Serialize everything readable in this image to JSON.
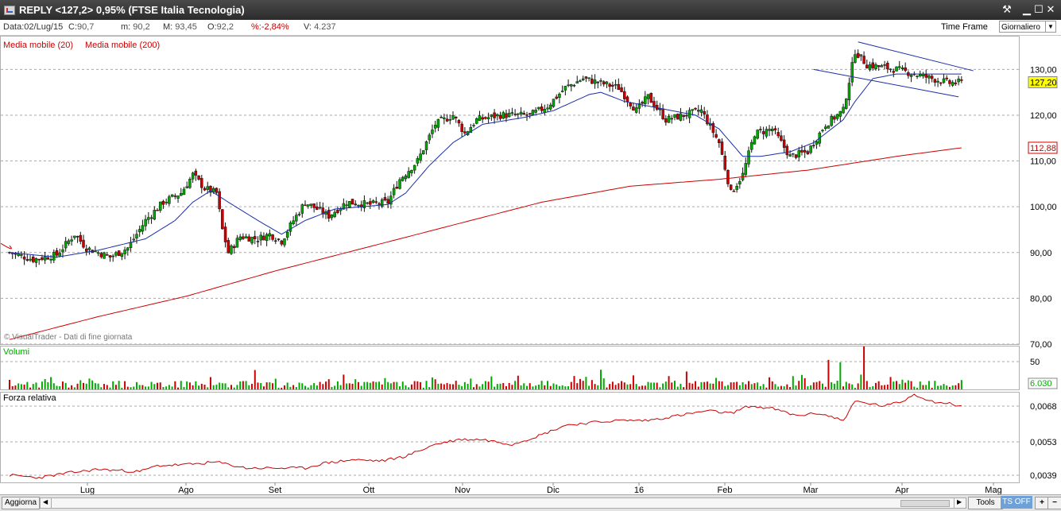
{
  "window": {
    "title": "REPLY <127,2> 0,95%  (FTSE Italia Tecnologia)",
    "controls": [
      "⚒",
      "▁",
      "☐",
      "✕"
    ]
  },
  "info": {
    "date": "Data:02/Lug/15",
    "close_label": "C:",
    "close": "90,7",
    "min_label": "m:",
    "min": "90,2",
    "max_label": "M:",
    "max": "93,45",
    "open_label": "O:",
    "open": "92,2",
    "pct_label": "%:",
    "pct": "-2,84%",
    "vol_label": "V:",
    "vol": "4.237",
    "timeframe_label": "Time Frame",
    "timeframe_value": "Giornaliero"
  },
  "bottom": {
    "update_label": "Aggiorna",
    "tools_label": "Tools",
    "ts_label": "TS OFF",
    "add": "+",
    "remove": "−"
  },
  "chart_data": [
    {
      "type": "candlestick",
      "legend": [
        "Media mobile (20)",
        "Media mobile (200)"
      ],
      "watermark": "© VisualTrader - Dati di fine giornata",
      "ylim": [
        70,
        137
      ],
      "y_ticks": [
        "70,00",
        "80,00",
        "90,00",
        "100,00",
        "110,00",
        "120,00",
        "130,00"
      ],
      "x_labels": [
        "Lug",
        "Ago",
        "Set",
        "Ott",
        "Nov",
        "Dic",
        "16",
        "Feb",
        "Mar",
        "Apr",
        "Mag"
      ],
      "price_waypoints": [
        [
          0,
          90
        ],
        [
          8,
          88.5
        ],
        [
          16,
          89.5
        ],
        [
          22,
          94
        ],
        [
          26,
          91
        ],
        [
          34,
          89
        ],
        [
          40,
          91
        ],
        [
          46,
          97
        ],
        [
          52,
          101
        ],
        [
          58,
          103
        ],
        [
          62,
          107
        ],
        [
          66,
          104
        ],
        [
          70,
          103
        ],
        [
          72,
          95
        ],
        [
          74,
          90
        ],
        [
          78,
          93.5
        ],
        [
          84,
          93
        ],
        [
          88,
          94
        ],
        [
          92,
          92.5
        ],
        [
          96,
          97
        ],
        [
          100,
          101
        ],
        [
          108,
          98
        ],
        [
          114,
          101
        ],
        [
          122,
          100.5
        ],
        [
          128,
          101
        ],
        [
          132,
          106
        ],
        [
          138,
          110
        ],
        [
          144,
          118
        ],
        [
          150,
          120
        ],
        [
          154,
          116
        ],
        [
          158,
          119
        ],
        [
          166,
          120
        ],
        [
          176,
          120
        ],
        [
          182,
          122
        ],
        [
          188,
          126
        ],
        [
          194,
          128
        ],
        [
          200,
          127
        ],
        [
          206,
          126
        ],
        [
          212,
          121
        ],
        [
          216,
          124
        ],
        [
          222,
          119
        ],
        [
          228,
          120
        ],
        [
          234,
          121
        ],
        [
          240,
          114
        ],
        [
          244,
          103
        ],
        [
          248,
          107
        ],
        [
          252,
          116
        ],
        [
          258,
          117
        ],
        [
          264,
          111
        ],
        [
          270,
          112
        ],
        [
          276,
          118
        ],
        [
          282,
          121
        ],
        [
          286,
          134
        ],
        [
          290,
          131
        ],
        [
          300,
          130
        ],
        [
          306,
          129
        ],
        [
          312,
          128
        ],
        [
          318,
          127
        ],
        [
          322,
          127.2
        ]
      ],
      "ma20_waypoints": [
        [
          0,
          90
        ],
        [
          16,
          89
        ],
        [
          30,
          90.5
        ],
        [
          46,
          93
        ],
        [
          56,
          97
        ],
        [
          62,
          101
        ],
        [
          68,
          103.5
        ],
        [
          74,
          101
        ],
        [
          84,
          97
        ],
        [
          92,
          94
        ],
        [
          100,
          97
        ],
        [
          110,
          99.5
        ],
        [
          128,
          100.5
        ],
        [
          134,
          103
        ],
        [
          142,
          109
        ],
        [
          150,
          114
        ],
        [
          160,
          118
        ],
        [
          174,
          119.5
        ],
        [
          184,
          121
        ],
        [
          196,
          124.5
        ],
        [
          200,
          125
        ],
        [
          208,
          123
        ],
        [
          216,
          122
        ],
        [
          224,
          121
        ],
        [
          232,
          120
        ],
        [
          240,
          117
        ],
        [
          248,
          111
        ],
        [
          254,
          111
        ],
        [
          264,
          112
        ],
        [
          272,
          114
        ],
        [
          282,
          119
        ],
        [
          286,
          123
        ],
        [
          292,
          128
        ],
        [
          300,
          129
        ],
        [
          310,
          129
        ],
        [
          322,
          129
        ]
      ],
      "ma200_waypoints": [
        [
          0,
          71
        ],
        [
          30,
          76
        ],
        [
          60,
          80.5
        ],
        [
          90,
          86
        ],
        [
          120,
          91
        ],
        [
          150,
          96
        ],
        [
          180,
          101
        ],
        [
          210,
          104.5
        ],
        [
          240,
          106
        ],
        [
          270,
          108
        ],
        [
          300,
          111
        ],
        [
          322,
          112.88
        ]
      ],
      "trendlines": [
        {
          "from": [
            287,
            136
          ],
          "to": [
            326,
            129.7
          ]
        },
        {
          "from": [
            272,
            130
          ],
          "to": [
            321,
            124
          ]
        }
      ],
      "last_price": "127,20",
      "ma200_last": "112,88",
      "last_price_color": "#ffff00",
      "ma200_last_color": "#cc0000",
      "up_color": "#00aa00",
      "down_color": "#cc0000",
      "ma20_color": "#1a2fa8",
      "ma200_color": "#cc0000"
    },
    {
      "type": "bar",
      "title": "Volumi",
      "y_ticks": [
        "50"
      ],
      "last_value": "6.030",
      "spikes": [
        [
          68,
          25
        ],
        [
          113,
          30
        ],
        [
          156,
          22
        ],
        [
          200,
          40
        ],
        [
          277,
          60
        ],
        [
          281,
          55
        ],
        [
          288,
          30
        ],
        [
          289,
          88
        ]
      ]
    },
    {
      "type": "line",
      "title": "Forza relativa",
      "y_ticks": [
        "0,0068",
        "0,0053",
        "0,0039"
      ],
      "ylim": [
        0.0036,
        0.0074
      ],
      "waypoints": [
        [
          0,
          0.0039
        ],
        [
          10,
          0.0038
        ],
        [
          20,
          0.004
        ],
        [
          30,
          0.00415
        ],
        [
          44,
          0.00405
        ],
        [
          50,
          0.0043
        ],
        [
          60,
          0.00435
        ],
        [
          70,
          0.00445
        ],
        [
          80,
          0.0042
        ],
        [
          92,
          0.0042
        ],
        [
          100,
          0.0042
        ],
        [
          106,
          0.0044
        ],
        [
          116,
          0.00455
        ],
        [
          126,
          0.0045
        ],
        [
          134,
          0.0047
        ],
        [
          144,
          0.0052
        ],
        [
          152,
          0.0054
        ],
        [
          160,
          0.0054
        ],
        [
          170,
          0.0052
        ],
        [
          180,
          0.0056
        ],
        [
          188,
          0.006
        ],
        [
          196,
          0.0061
        ],
        [
          206,
          0.0062
        ],
        [
          216,
          0.0062
        ],
        [
          226,
          0.0064
        ],
        [
          236,
          0.0066
        ],
        [
          244,
          0.0065
        ],
        [
          250,
          0.0068
        ],
        [
          258,
          0.0067
        ],
        [
          266,
          0.0064
        ],
        [
          274,
          0.0065
        ],
        [
          282,
          0.0062
        ],
        [
          286,
          0.007
        ],
        [
          296,
          0.0068
        ],
        [
          302,
          0.007
        ],
        [
          306,
          0.0073
        ],
        [
          312,
          0.007
        ],
        [
          318,
          0.0069
        ],
        [
          322,
          0.0068
        ]
      ]
    }
  ]
}
